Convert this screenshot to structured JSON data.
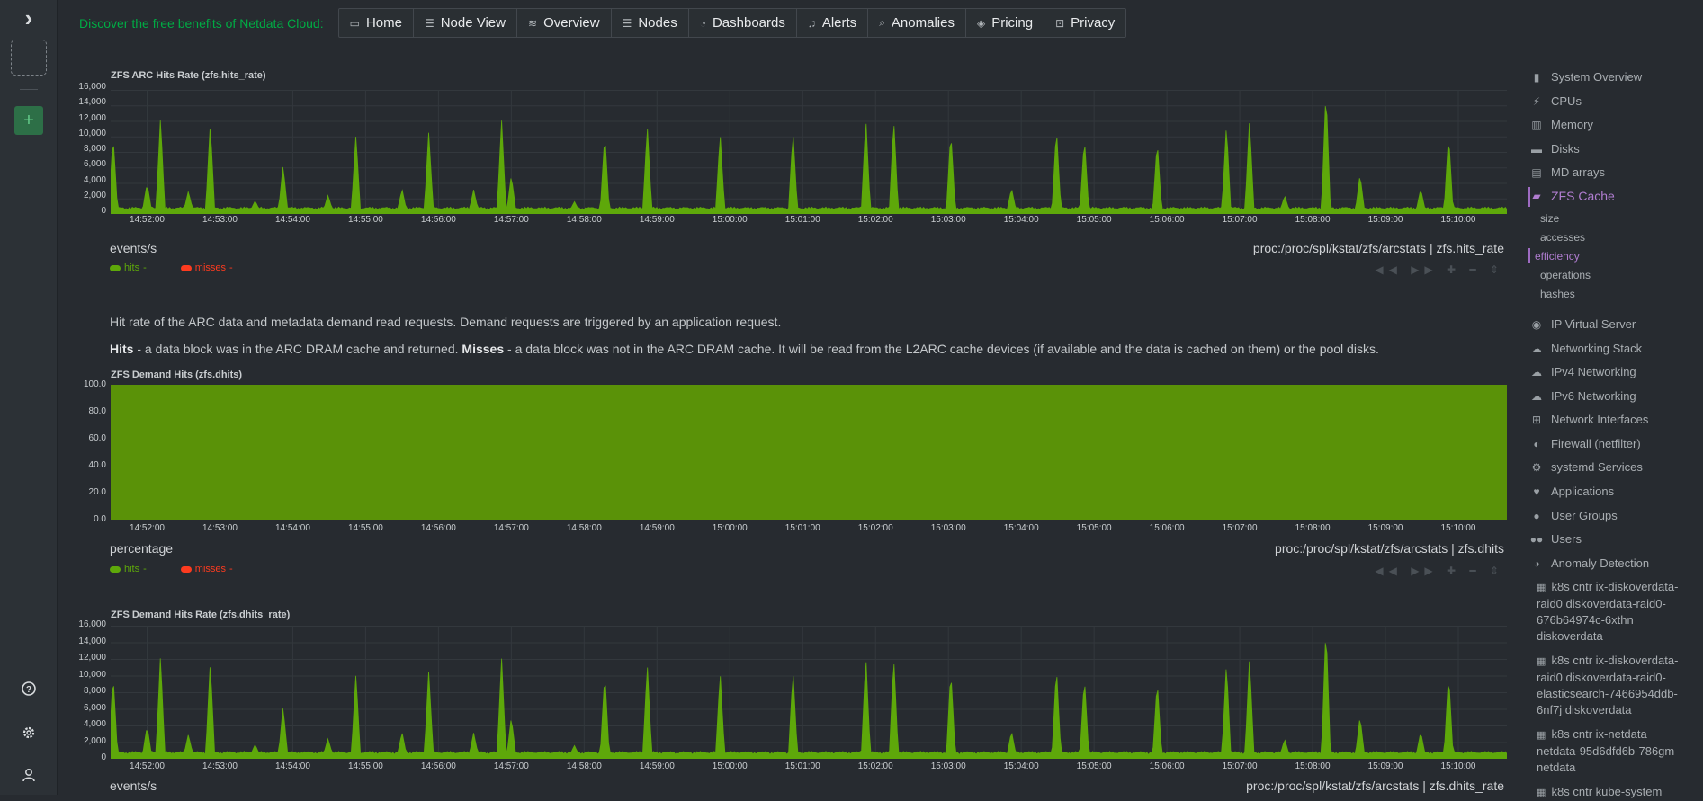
{
  "promo_text": "Discover the free benefits of Netdata Cloud:",
  "nav": [
    {
      "label": "Home",
      "icon": "monitor-icon"
    },
    {
      "label": "Node View",
      "icon": "server-icon"
    },
    {
      "label": "Overview",
      "icon": "overview-icon"
    },
    {
      "label": "Nodes",
      "icon": "nodes-icon"
    },
    {
      "label": "Dashboards",
      "icon": "gauge-icon"
    },
    {
      "label": "Alerts",
      "icon": "bell-icon"
    },
    {
      "label": "Anomalies",
      "icon": "anomaly-icon"
    },
    {
      "label": "Pricing",
      "icon": "shield-icon"
    },
    {
      "label": "Privacy",
      "icon": "lock-icon"
    }
  ],
  "colors": {
    "hits": "#5ea80a",
    "misses": "#fd3b1f",
    "accent": "#00ab44",
    "active": "#b07dd0"
  },
  "time_ticks": [
    "14:52:00",
    "14:53:00",
    "14:54:00",
    "14:55:00",
    "14:56:00",
    "14:57:00",
    "14:58:00",
    "14:59:00",
    "15:00:00",
    "15:01:00",
    "15:02:00",
    "15:03:00",
    "15:04:00",
    "15:05:00",
    "15:06:00",
    "15:07:00",
    "15:08:00",
    "15:09:00",
    "15:10:00"
  ],
  "charts": {
    "hits_rate": {
      "title": "ZFS ARC Hits Rate (zfs.hits_rate)",
      "units": "events/s",
      "context": "proc:/proc/spl/kstat/zfs/arcstats | zfs.hits_rate",
      "yticks": [
        "16,000",
        "14,000",
        "12,000",
        "10,000",
        "8,000",
        "6,000",
        "4,000",
        "2,000",
        "0"
      ],
      "legend": [
        {
          "name": "hits",
          "value": "-"
        },
        {
          "name": "misses",
          "value": "-"
        }
      ]
    },
    "dhits": {
      "title": "ZFS Demand Hits (zfs.dhits)",
      "units": "percentage",
      "context": "proc:/proc/spl/kstat/zfs/arcstats | zfs.dhits",
      "yticks": [
        "100.0",
        "80.0",
        "60.0",
        "40.0",
        "20.0",
        "0.0"
      ],
      "legend": [
        {
          "name": "hits",
          "value": "-"
        },
        {
          "name": "misses",
          "value": "-"
        }
      ]
    },
    "dhits_rate": {
      "title": "ZFS Demand Hits Rate (zfs.dhits_rate)",
      "units": "events/s",
      "context": "proc:/proc/spl/kstat/zfs/arcstats | zfs.dhits_rate",
      "yticks": [
        "16,000",
        "14,000",
        "12,000",
        "10,000",
        "8,000",
        "6,000",
        "4,000",
        "2,000",
        "0"
      ]
    }
  },
  "chart_data": [
    {
      "type": "area",
      "title": "ZFS ARC Hits Rate (zfs.hits_rate)",
      "ylabel": "events/s",
      "ylim": [
        0,
        17000
      ],
      "x_range": [
        "14:51:30",
        "15:10:40"
      ],
      "series": [
        {
          "name": "hits",
          "baseline": 500,
          "spikes": [
            {
              "t": "14:51:32",
              "v": 10800
            },
            {
              "t": "14:52:00",
              "v": 4200
            },
            {
              "t": "14:52:11",
              "v": 13200
            },
            {
              "t": "14:52:34",
              "v": 3100
            },
            {
              "t": "14:52:52",
              "v": 12400
            },
            {
              "t": "14:53:29",
              "v": 1800
            },
            {
              "t": "14:53:52",
              "v": 6700
            },
            {
              "t": "14:54:29",
              "v": 2600
            },
            {
              "t": "14:54:52",
              "v": 10900
            },
            {
              "t": "14:55:30",
              "v": 3400
            },
            {
              "t": "14:55:52",
              "v": 11300
            },
            {
              "t": "14:56:29",
              "v": 3300
            },
            {
              "t": "14:56:52",
              "v": 12800
            },
            {
              "t": "14:57:00",
              "v": 5300
            },
            {
              "t": "14:57:52",
              "v": 1700
            },
            {
              "t": "14:58:17",
              "v": 11000
            },
            {
              "t": "14:58:52",
              "v": 12000
            },
            {
              "t": "14:59:52",
              "v": 11000
            },
            {
              "t": "15:00:52",
              "v": 11200
            },
            {
              "t": "15:01:52",
              "v": 13300
            },
            {
              "t": "15:02:15",
              "v": 13000
            },
            {
              "t": "15:03:02",
              "v": 11300
            },
            {
              "t": "15:03:52",
              "v": 3500
            },
            {
              "t": "15:04:29",
              "v": 11800
            },
            {
              "t": "15:04:52",
              "v": 10400
            },
            {
              "t": "15:05:52",
              "v": 10000
            },
            {
              "t": "15:06:49",
              "v": 12300
            },
            {
              "t": "15:07:08",
              "v": 12800
            },
            {
              "t": "15:07:37",
              "v": 2500
            },
            {
              "t": "15:08:11",
              "v": 17000
            },
            {
              "t": "15:08:39",
              "v": 5400
            },
            {
              "t": "15:09:29",
              "v": 3400
            },
            {
              "t": "15:09:52",
              "v": 10900
            }
          ]
        },
        {
          "name": "misses",
          "values": "near zero"
        }
      ]
    },
    {
      "type": "area",
      "title": "ZFS Demand Hits (zfs.dhits)",
      "ylabel": "percentage",
      "ylim": [
        0,
        100
      ],
      "series": [
        {
          "name": "hits",
          "constant": 100
        },
        {
          "name": "misses",
          "constant": 0
        }
      ]
    },
    {
      "type": "area",
      "title": "ZFS Demand Hits Rate (zfs.dhits_rate)",
      "ylabel": "events/s",
      "ylim": [
        0,
        17000
      ],
      "series": [
        {
          "name": "hits",
          "note": "mirrors zfs.hits_rate"
        }
      ]
    }
  ],
  "description": {
    "line1": "Hit rate of the ARC data and metadata demand read requests. Demand requests are triggered by an application request.",
    "hits_label": "Hits",
    "hits_text": " - a data block was in the ARC DRAM cache and returned. ",
    "misses_label": "Misses",
    "misses_text": " - a data block was not in the ARC DRAM cache. It will be read from the L2ARC cache devices (if available and the data is cached on them) or the pool disks."
  },
  "menu": {
    "items": [
      {
        "label": "System Overview",
        "icon": "bookmark-icon"
      },
      {
        "label": "CPUs",
        "icon": "bolt-icon"
      },
      {
        "label": "Memory",
        "icon": "memory-icon"
      },
      {
        "label": "Disks",
        "icon": "disk-icon"
      },
      {
        "label": "MD arrays",
        "icon": "raid-icon"
      },
      {
        "label": "ZFS Cache",
        "icon": "folder-open-icon"
      }
    ],
    "subitems": [
      "size",
      "accesses",
      "efficiency",
      "operations",
      "hashes"
    ],
    "items2": [
      {
        "label": "IP Virtual Server",
        "icon": "eye-icon"
      },
      {
        "label": "Networking Stack",
        "icon": "cloud-icon"
      },
      {
        "label": "IPv4 Networking",
        "icon": "cloud-icon"
      },
      {
        "label": "IPv6 Networking",
        "icon": "cloud-icon"
      },
      {
        "label": "Network Interfaces",
        "icon": "sitemap-icon"
      },
      {
        "label": "Firewall (netfilter)",
        "icon": "shield-icon"
      },
      {
        "label": "systemd Services",
        "icon": "cogs-icon"
      },
      {
        "label": "Applications",
        "icon": "heartbeat-icon"
      },
      {
        "label": "User Groups",
        "icon": "user-icon"
      },
      {
        "label": "Users",
        "icon": "users-icon"
      },
      {
        "label": "Anomaly Detection",
        "icon": "half-circle-icon"
      }
    ],
    "k8s": [
      "k8s cntr ix-diskoverdata-raid0 diskoverdata-raid0-676b64974c-6xthn diskoverdata",
      "k8s cntr ix-diskoverdata-raid0 diskoverdata-raid0-elasticsearch-7466954ddb-6nf7j diskoverdata",
      "k8s cntr ix-netdata netdata-95d6dfd6b-786gm netdata",
      "k8s cntr kube-system"
    ]
  }
}
